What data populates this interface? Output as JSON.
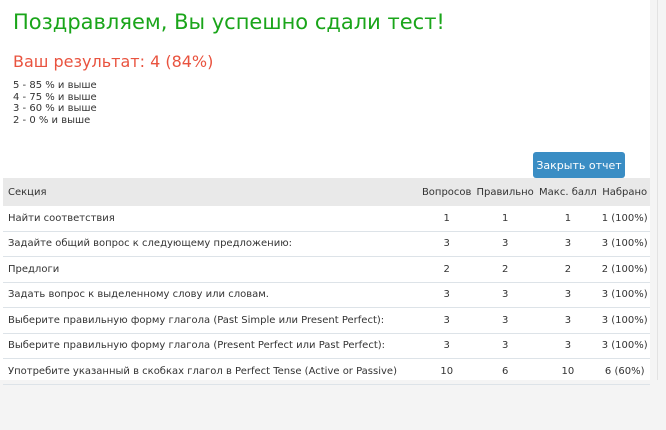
{
  "title": "Поздравляем, Вы успешно сдали тест!",
  "result": "Ваш результат: 4 (84%)",
  "scale": [
    "5 - 85 % и выше",
    "4 - 75 % и выше",
    "3 - 60 % и выше",
    "2 - 0 % и выше"
  ],
  "close_button": "Закрыть отчет",
  "columns": [
    "Секция",
    "Вопросов",
    "Правильно",
    "Макс. балл",
    "Набрано"
  ],
  "rows": [
    [
      "Найти соответствия",
      "1",
      "1",
      "1",
      "1 (100%)"
    ],
    [
      "Задайте общий вопрос к следующему предложению:",
      "3",
      "3",
      "3",
      "3 (100%)"
    ],
    [
      "Предлоги",
      "2",
      "2",
      "2",
      "2 (100%)"
    ],
    [
      "Задать вопрос к выделенному слову или словам.",
      "3",
      "3",
      "3",
      "3 (100%)"
    ],
    [
      "Выберите правильную форму глагола (Past Simple или Present Perfect):",
      "3",
      "3",
      "3",
      "3 (100%)"
    ],
    [
      "Выберите правильную форму глагола (Present Perfect или Past Perfect):",
      "3",
      "3",
      "3",
      "3 (100%)"
    ],
    [
      "Употребите указанный в скобках глагол в Perfect Tense (Active or Passive)",
      "10",
      "6",
      "10",
      "6 (60%)"
    ]
  ]
}
